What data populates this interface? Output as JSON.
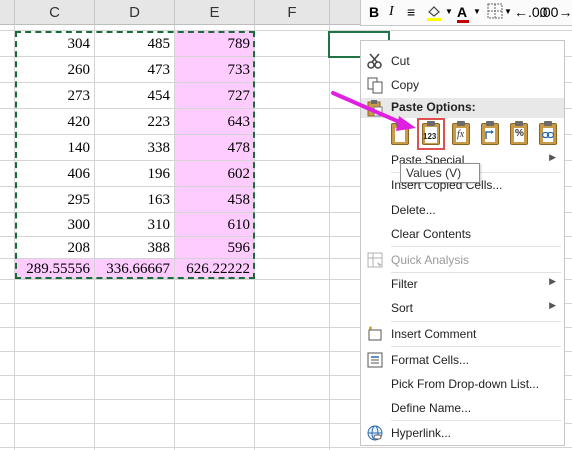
{
  "columns": [
    "C",
    "D",
    "E",
    "F"
  ],
  "rows": [
    [
      "304",
      "485",
      "789"
    ],
    [
      "260",
      "473",
      "733"
    ],
    [
      "273",
      "454",
      "727"
    ],
    [
      "420",
      "223",
      "643"
    ],
    [
      "140",
      "338",
      "478"
    ],
    [
      "406",
      "196",
      "602"
    ],
    [
      "295",
      "163",
      "458"
    ],
    [
      "300",
      "310",
      "610"
    ],
    [
      "208",
      "388",
      "596"
    ],
    [
      "289.55556",
      "336.66667",
      "626.22222"
    ]
  ],
  "mini_toolbar": {
    "bold": "B",
    "italic": "I",
    "align": "≡",
    "font_color_letter": "A",
    "decrease_decimal": "←.00",
    "increase_decimal": ".00→.0"
  },
  "menu": {
    "cut": "Cut",
    "copy": "Copy",
    "paste_options": "Paste Options:",
    "paste_special": "Paste Special",
    "insert_copied_cells": "Insert Copied Cells...",
    "delete": "Delete...",
    "clear_contents": "Clear Contents",
    "quick_analysis": "Quick Analysis",
    "filter": "Filter",
    "sort": "Sort",
    "insert_comment": "Insert Comment",
    "format_cells": "Format Cells...",
    "pick_list": "Pick From Drop-down List...",
    "define_name": "Define Name...",
    "hyperlink": "Hyperlink..."
  },
  "paste_buttons": [
    "paste-icon",
    "values-123-icon",
    "formulas-fx-icon",
    "transpose-icon",
    "formatting-percent-icon",
    "paste-link-icon"
  ],
  "values_label": "123",
  "fx_label": "fx",
  "percent_label": "%",
  "tooltip": "Values (V)",
  "colors": {
    "pink_fill": "#ffccff",
    "marquee": "#1a6b3a",
    "arrow": "#e020e0",
    "highlight_border": "#e05050"
  }
}
